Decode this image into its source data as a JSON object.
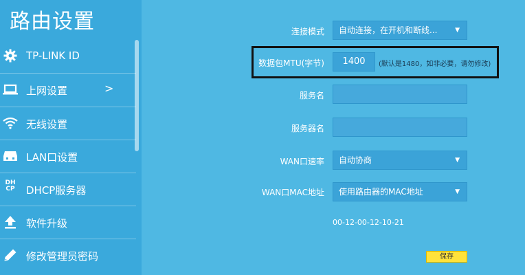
{
  "sidebar": {
    "title": "路由设置",
    "items": [
      {
        "label": "TP-LINK ID",
        "icon": "gear-icon"
      },
      {
        "label": "上网设置",
        "icon": "laptop-icon",
        "chevron": ">"
      },
      {
        "label": "无线设置",
        "icon": "wifi-icon"
      },
      {
        "label": "LAN口设置",
        "icon": "network-icon"
      },
      {
        "label": "DHCP服务器",
        "icon": "dhcp-icon",
        "icon_text": "DH CP"
      },
      {
        "label": "软件升级",
        "icon": "upload-icon"
      },
      {
        "label": "修改管理员密码",
        "icon": "pencil-icon"
      }
    ]
  },
  "form": {
    "connect_mode": {
      "label": "连接模式",
      "value": "自动连接，在开机和断线..."
    },
    "mtu": {
      "label": "数据包MTU(字节)",
      "value": "1400",
      "hint": "(默认是1480，如非必要，请勿修改)"
    },
    "service_name": {
      "label": "服务名",
      "value": ""
    },
    "server_name": {
      "label": "服务器名",
      "value": ""
    },
    "wan_speed": {
      "label": "WAN口速率",
      "value": "自动协商"
    },
    "wan_mac": {
      "label": "WAN口MAC地址",
      "value": "使用路由器的MAC地址",
      "mac": "00-12-00-12-10-21"
    },
    "save_label": "保存"
  },
  "colors": {
    "background": "#4fb8e3",
    "sidebar": "#3aa9dc",
    "save_button": "#ffe23b",
    "highlight": "#111111"
  }
}
